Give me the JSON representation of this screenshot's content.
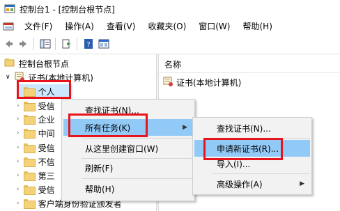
{
  "window": {
    "title": "控制台1 - [控制台根节点]"
  },
  "menubar": {
    "items": [
      "文件(F)",
      "操作(A)",
      "查看(V)",
      "收藏夹(O)",
      "窗口(W)",
      "帮助(H)"
    ]
  },
  "toolbar": {
    "icons": [
      "back-arrow-icon",
      "forward-arrow-icon",
      "console-tree-icon",
      "export-list-icon",
      "help-icon",
      "console-view-icon"
    ]
  },
  "tree": {
    "root": "控制台根节点",
    "cert_node": "证书(本地计算机)",
    "children": [
      "个人",
      "受信",
      "企业",
      "中间",
      "受信",
      "不信",
      "第三",
      "受信",
      "客户端身份验证颁发者"
    ]
  },
  "right_pane": {
    "header": "名称",
    "items": [
      "证书(本地计算机)"
    ]
  },
  "context_menu": {
    "items": [
      "查找证书(N)...",
      "所有任务(K)",
      "从这里创建窗口(W)",
      "刷新(F)",
      "帮助(H)"
    ]
  },
  "submenu": {
    "items": [
      "查找证书(N)...",
      "申请新证书(R)...",
      "导入(I)...",
      "高级操作(A)"
    ]
  },
  "colors": {
    "highlight": "#91c9f7",
    "annotation_red": "#e8141c",
    "folder": "#f4d27a"
  }
}
